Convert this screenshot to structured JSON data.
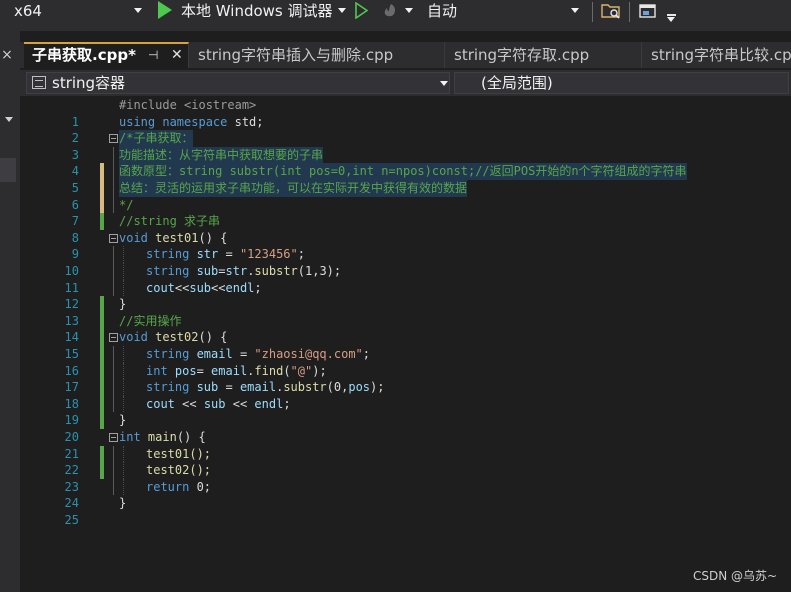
{
  "toolbar": {
    "platform": "x64",
    "debugger": "本地 Windows 调试器",
    "config": "自动"
  },
  "colors": {
    "accent_tab": "#d9a23a",
    "saved_change": "#57a64a",
    "unsaved_change": "#d7ba7d",
    "keyword": "#569cd6",
    "comment": "#57a64a",
    "string": "#d69d85",
    "line_number": "#2b91af"
  },
  "left_panel": {
    "close_icon": "×"
  },
  "tabs": [
    {
      "label": "子串获取.cpp*",
      "active": true,
      "pin": "⊣",
      "close": "✕"
    },
    {
      "label": "string字符串插入与删除.cpp",
      "active": false
    },
    {
      "label": "string字符存取.cpp",
      "active": false
    },
    {
      "label": "string字符串比较.cpp",
      "active": false
    }
  ],
  "navbar": {
    "scope": "string容器",
    "member": "(全局范围)"
  },
  "editor": {
    "line_numbers": [
      "1",
      "2",
      "3",
      "4",
      "5",
      "6",
      "7",
      "8",
      "9",
      "10",
      "11",
      "12",
      "13",
      "14",
      "15",
      "16",
      "17",
      "18",
      "19",
      "20",
      "21",
      "22",
      "23",
      "24",
      "25"
    ]
  },
  "code": {
    "l1": "#include <iostream>",
    "l2a": "using namespace",
    "l2b": " std;",
    "l3": "/*子串获取：",
    "l4": "功能描述：从字符串中获取想要的子串",
    "l5": "函数原型：string substr(int pos=0,int n=npos)const;//返回POS开始的n个字符组成的字符串",
    "l6": "总结：灵活的运用求子串功能，可以在实际开发中获得有效的数据",
    "l7": "*/",
    "l8": "//string 求子串",
    "l9a": "void",
    "l9b": " test01",
    "l9c": "() {",
    "l10a": "string",
    "l10b": " str",
    "l10c": " = ",
    "l10d": "\"123456\"",
    "l10e": ";",
    "l11a": "string",
    "l11b": " sub",
    "l11c": "=",
    "l11d": "str",
    "l11e": ".",
    "l11f": "substr",
    "l11g": "(1,3);",
    "l12a": "cout",
    "l12b": "<<",
    "l12c": "sub",
    "l12d": "<<",
    "l12e": "endl",
    "l12f": ";",
    "l13": "}",
    "l14": "//实用操作",
    "l15a": "void",
    "l15b": " test02",
    "l15c": "() {",
    "l16a": "string",
    "l16b": " email",
    "l16c": " = ",
    "l16d": "\"zhaosi@qq.com\"",
    "l16e": ";",
    "l17a": "int",
    "l17b": " pos",
    "l17c": "= ",
    "l17d": "email",
    "l17e": ".",
    "l17f": "find",
    "l17g": "(",
    "l17h": "\"@\"",
    "l17i": ");",
    "l18a": "string",
    "l18b": " sub",
    "l18c": " = ",
    "l18d": "email",
    "l18e": ".",
    "l18f": "substr",
    "l18g": "(0,",
    "l18h": "pos",
    "l18i": ");",
    "l19a": "cout",
    "l19b": " << ",
    "l19c": "sub",
    "l19d": " << ",
    "l19e": "endl",
    "l19f": ";",
    "l20": "}",
    "l21a": "int",
    "l21b": " main",
    "l21c": "() {",
    "l22": "test01();",
    "l23": "test02();",
    "l24a": "return",
    "l24b": " 0;",
    "l25": "}"
  },
  "watermark": "CSDN @乌苏~"
}
